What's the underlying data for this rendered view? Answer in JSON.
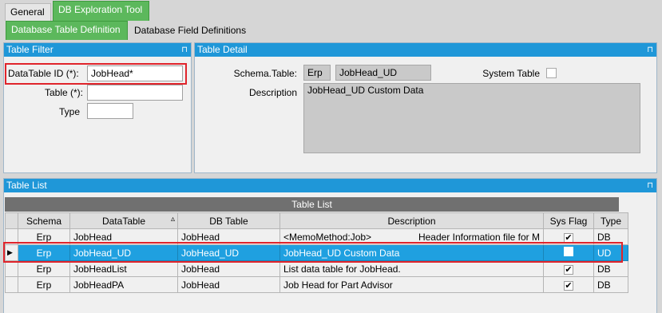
{
  "top_tabs": [
    {
      "label": "General"
    },
    {
      "label": "DB Exploration Tool"
    }
  ],
  "sub_tabs": [
    {
      "label": "Database Table Definition"
    },
    {
      "label": "Database Field Definitions"
    }
  ],
  "table_filter": {
    "title": "Table Filter",
    "pin_icon": "pin-icon",
    "datatable_id_label": "DataTable ID (*):",
    "datatable_id_value": "JobHead*",
    "table_label": "Table (*):",
    "table_value": "",
    "type_label": "Type",
    "type_value": ""
  },
  "table_detail": {
    "title": "Table Detail",
    "schema_table_label": "Schema.Table:",
    "schema_value": "Erp",
    "table_value": "JobHead_UD",
    "system_table_label": "System Table",
    "description_label": "Description",
    "description_value": "JobHead_UD Custom Data"
  },
  "table_list": {
    "title": "Table List",
    "caption": "Table List",
    "columns": [
      "Schema",
      "DataTable",
      "DB Table",
      "Description",
      "Sys Flag",
      "Type"
    ],
    "rows": [
      {
        "schema": "Erp",
        "datatable": "JobHead",
        "dbtable": "JobHead",
        "description": "<MemoMethod:Job>",
        "description_right": "Header Information file for M",
        "sysflag": "✔",
        "type": "DB"
      },
      {
        "schema": "Erp",
        "datatable": "JobHead_UD",
        "dbtable": "JobHead_UD",
        "description": "JobHead_UD Custom Data",
        "description_right": "",
        "sysflag": "",
        "type": "UD"
      },
      {
        "schema": "Erp",
        "datatable": "JobHeadList",
        "dbtable": "JobHead",
        "description": "List data table for JobHead.",
        "description_right": "",
        "sysflag": "✔",
        "type": "DB"
      },
      {
        "schema": "Erp",
        "datatable": "JobHeadPA",
        "dbtable": "JobHead",
        "description": "Job Head for Part Advisor",
        "description_right": "",
        "sysflag": "✔",
        "type": "DB"
      }
    ],
    "sort_indicator": "▵",
    "row_pointer": "▶"
  },
  "pin_glyph": "⊓"
}
